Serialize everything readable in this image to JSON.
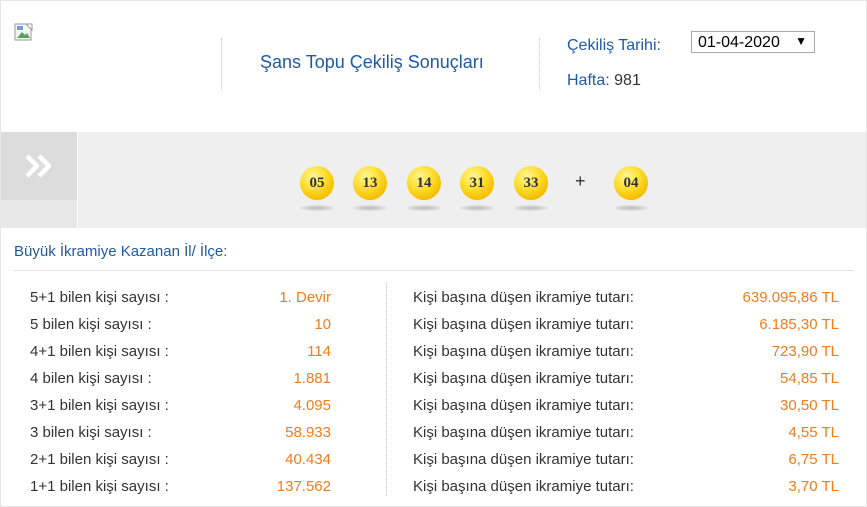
{
  "header": {
    "title": "Şans Topu Çekiliş Sonuçları",
    "date_label": "Çekiliş Tarihi:",
    "date_value": "01-04-2020",
    "week_label": "Hafta:",
    "week_value": "981"
  },
  "balls": {
    "main": [
      "05",
      "13",
      "14",
      "31",
      "33"
    ],
    "plus_sign": "+",
    "extra": "04"
  },
  "results": {
    "title": "Büyük İkramiye Kazanan İl/ İlçe:",
    "rows": [
      {
        "label": "5+1 bilen kişi sayısı :",
        "count": "1. Devir",
        "prize_label": "Kişi başına düşen ikramiye tutarı:",
        "amount": "639.095,86 TL"
      },
      {
        "label": "5 bilen kişi sayısı :",
        "count": "10",
        "prize_label": "Kişi başına düşen ikramiye tutarı:",
        "amount": "6.185,30 TL"
      },
      {
        "label": "4+1 bilen kişi sayısı :",
        "count": "114",
        "prize_label": "Kişi başına düşen ikramiye tutarı:",
        "amount": "723,90 TL"
      },
      {
        "label": "4 bilen kişi sayısı :",
        "count": "1.881",
        "prize_label": "Kişi başına düşen ikramiye tutarı:",
        "amount": "54,85 TL"
      },
      {
        "label": "3+1 bilen kişi sayısı :",
        "count": "4.095",
        "prize_label": "Kişi başına düşen ikramiye tutarı:",
        "amount": "30,50 TL"
      },
      {
        "label": "3 bilen kişi sayısı :",
        "count": "58.933",
        "prize_label": "Kişi başına düşen ikramiye tutarı:",
        "amount": "4,55 TL"
      },
      {
        "label": "2+1 bilen kişi sayısı :",
        "count": "40.434",
        "prize_label": "Kişi başına düşen ikramiye tutarı:",
        "amount": "6,75 TL"
      },
      {
        "label": "1+1 bilen kişi sayısı :",
        "count": "137.562",
        "prize_label": "Kişi başına düşen ikramiye tutarı:",
        "amount": "3,70 TL"
      }
    ]
  },
  "colors": {
    "title_blue": "#1e5aa6",
    "value_orange": "#f07c1e",
    "ball_yellow": "#ffe23a",
    "band_gray": "#efefef"
  },
  "icons": {
    "logo": "broken-image-icon",
    "nav": "double-chevron-right-icon",
    "dropdown": "caret-down-icon"
  }
}
